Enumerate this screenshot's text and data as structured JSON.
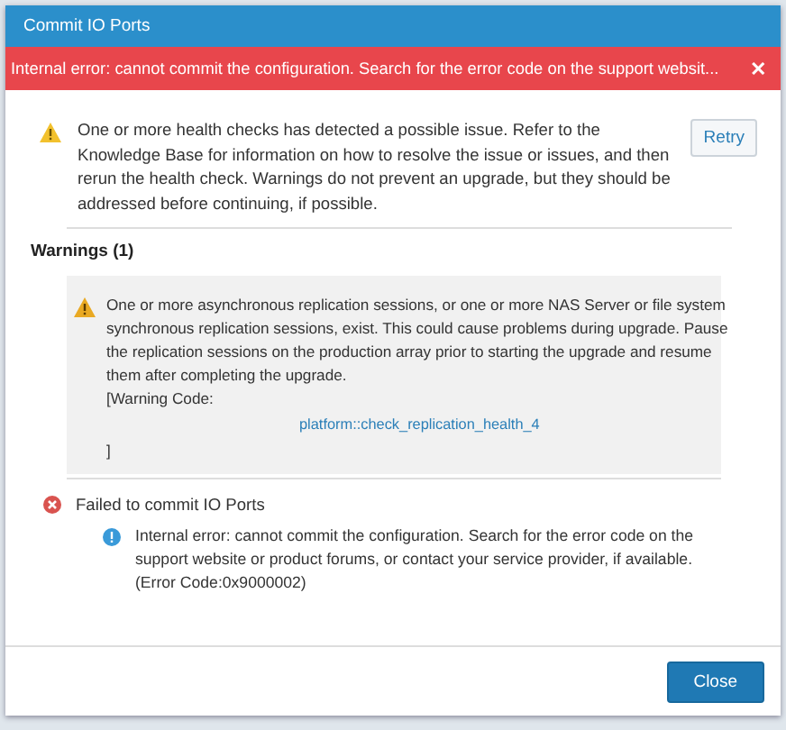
{
  "window": {
    "title": "Commit IO Ports"
  },
  "error_banner": {
    "message": "Internal error: cannot commit the configuration. Search for the error code on the support websit...",
    "close": "✕"
  },
  "health_check": {
    "message": "One or more health checks has detected a possible issue. Refer to the Knowledge Base for information on how to resolve the issue or issues, and then rerun the health check. Warnings do not prevent an upgrade, but they should be addressed before continuing, if possible.",
    "button": "Retry"
  },
  "warnings": {
    "heading": "Warnings (1)",
    "items": [
      {
        "message": "One or more asynchronous replication sessions, or one or more NAS Server or file system synchronous replication sessions, exist. This could cause problems during upgrade. Pause the replication sessions on the production array prior to starting the upgrade and resume them after completing the upgrade.",
        "code_label": "[Warning Code:",
        "code": "platform::check_replication_health_4",
        "code_end": "]"
      }
    ]
  },
  "failure": {
    "title": "Failed to commit IO Ports",
    "detail": "Internal error: cannot commit the configuration. Search for the error code on the support website or product forums, or contact your service provider, if available. (Error Code:0x9000002)"
  },
  "footer": {
    "button": "Close"
  }
}
